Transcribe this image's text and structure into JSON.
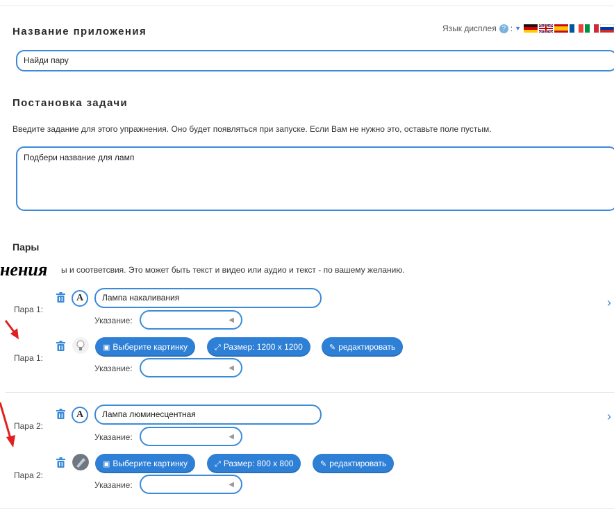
{
  "app_name": {
    "title": "Название приложения",
    "value": "Найди пару"
  },
  "language": {
    "label": "Язык дисплея",
    "help": "?",
    "colon": ":",
    "flags": [
      "de-flag",
      "uk-flag",
      "es-flag",
      "fr-flag",
      "it-flag",
      "ru-flag"
    ]
  },
  "task": {
    "title": "Постановка задачи",
    "help": "Введите задание для этого упражнения. Оно будет появляться при запуске. Если Вам не нужно это, оставьте поле пустым.",
    "value": "Подбери название для ламп"
  },
  "pairs": {
    "title": "Пары",
    "help": "ы и соответсвия. Это может быть текст и видео или аудио и текст - по вашему желанию.",
    "overlay": "нения",
    "hint_label": "Указание:",
    "items": [
      {
        "label1": "Пара 1:",
        "text": "Лампа накаливания",
        "label2": "Пара 1:",
        "select_image": "Выберите картинку",
        "size": "Размер: 1200 x 1200",
        "edit": "редактировать"
      },
      {
        "label1": "Пара 2:",
        "text": "Лампа люминесцентная",
        "label2": "Пара 2:",
        "select_image": "Выберите картинку",
        "size": "Размер: 800 x 800",
        "edit": "редактировать"
      }
    ]
  },
  "colors": {
    "accent": "#2e7fd6",
    "border": "#3b8ad8",
    "arrow": "#e02020"
  }
}
